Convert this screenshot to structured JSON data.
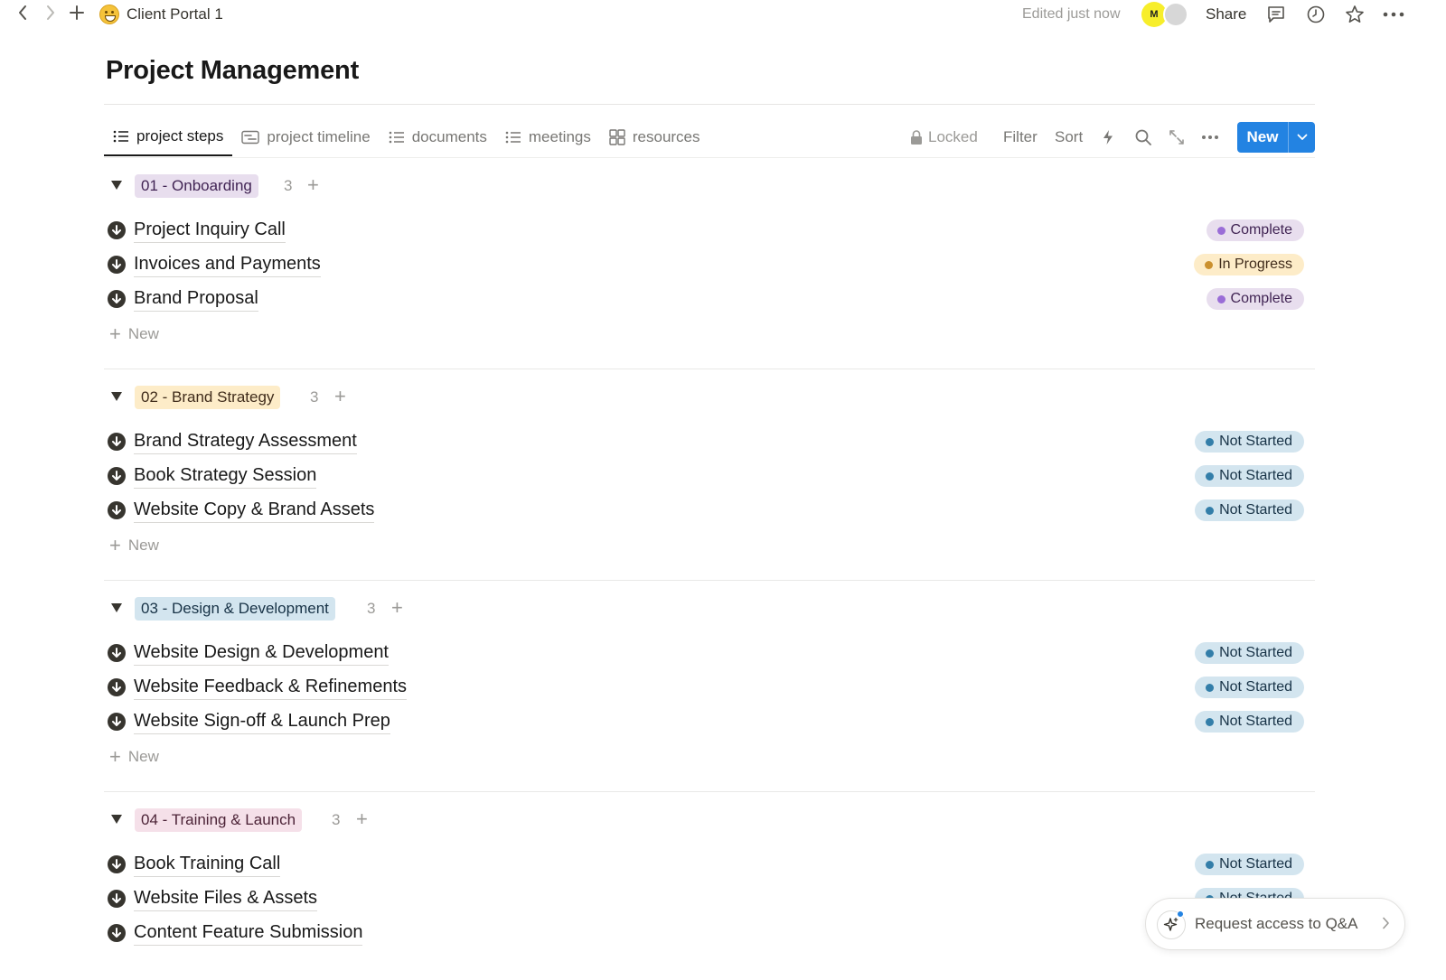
{
  "topbar": {
    "breadcrumb": "Client Portal 1",
    "edited": "Edited just now",
    "share_label": "Share",
    "avatar_initials": "M"
  },
  "page": {
    "title": "Project Management"
  },
  "tabs": [
    {
      "label": "project steps",
      "icon": "list-icon",
      "active": true
    },
    {
      "label": "project timeline",
      "icon": "timeline-icon",
      "active": false
    },
    {
      "label": "documents",
      "icon": "list-icon",
      "active": false
    },
    {
      "label": "meetings",
      "icon": "list-icon",
      "active": false
    },
    {
      "label": "resources",
      "icon": "gallery-icon",
      "active": false
    }
  ],
  "toolbar": {
    "locked_label": "Locked",
    "filter_label": "Filter",
    "sort_label": "Sort",
    "new_label": "New"
  },
  "groups": [
    {
      "label": "01 - Onboarding",
      "count": "3",
      "tag_bg": "#e8deee",
      "tag_fg": "#412454",
      "rows": [
        {
          "title": "Project Inquiry Call",
          "status": "Complete"
        },
        {
          "title": "Invoices and Payments",
          "status": "In Progress"
        },
        {
          "title": "Brand Proposal",
          "status": "Complete"
        }
      ],
      "add_label": "New"
    },
    {
      "label": "02 - Brand Strategy",
      "count": "3",
      "tag_bg": "#fdecc8",
      "tag_fg": "#402c1b",
      "rows": [
        {
          "title": "Brand Strategy Assessment",
          "status": "Not Started"
        },
        {
          "title": "Book Strategy Session",
          "status": "Not Started"
        },
        {
          "title": "Website Copy & Brand Assets",
          "status": "Not Started"
        }
      ],
      "add_label": "New"
    },
    {
      "label": "03 - Design & Development",
      "count": "3",
      "tag_bg": "#d3e5ef",
      "tag_fg": "#183347",
      "rows": [
        {
          "title": "Website Design & Development",
          "status": "Not Started"
        },
        {
          "title": "Website Feedback & Refinements",
          "status": "Not Started"
        },
        {
          "title": "Website Sign-off & Launch Prep",
          "status": "Not Started"
        }
      ],
      "add_label": "New"
    },
    {
      "label": "04 - Training & Launch",
      "count": "3",
      "tag_bg": "#f5e0e9",
      "tag_fg": "#4c2337",
      "rows": [
        {
          "title": "Book Training Call",
          "status": "Not Started"
        },
        {
          "title": "Website Files & Assets",
          "status": "Not Started"
        },
        {
          "title": "Content Feature Submission",
          "status": ""
        }
      ],
      "add_label": ""
    }
  ],
  "qa": {
    "label": "Request access to Q&A"
  },
  "colors": {
    "accent": "#2383e2"
  }
}
